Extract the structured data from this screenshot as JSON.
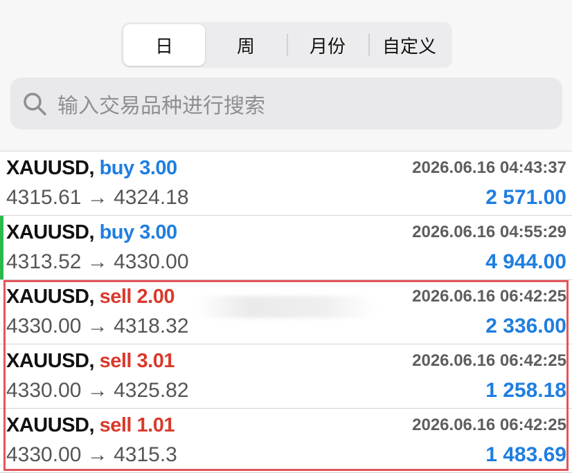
{
  "tabs": [
    {
      "label": "日",
      "active": true
    },
    {
      "label": "周",
      "active": false
    },
    {
      "label": "月份",
      "active": false
    },
    {
      "label": "自定义",
      "active": false
    }
  ],
  "search": {
    "placeholder": "输入交易品种进行搜索"
  },
  "colors": {
    "buy": "#1f7ee0",
    "sell": "#d9392b",
    "profit": "#1f7ee0",
    "accent_green": "#2db84d",
    "highlight": "#e2555a"
  },
  "trades": [
    {
      "symbol": "XAUUSD,",
      "side": "buy 3.00",
      "type": "buy",
      "time": "2026.06.16 04:43:37",
      "prices": "4315.61 → 4324.18",
      "profit": "2 571.00"
    },
    {
      "symbol": "XAUUSD,",
      "side": "buy 3.00",
      "type": "buy",
      "time": "2026.06.16 04:55:29",
      "prices": "4313.52 → 4330.00",
      "profit": "4 944.00",
      "accent": "green"
    },
    {
      "symbol": "XAUUSD,",
      "side": "sell 2.00",
      "type": "sell",
      "time": "2026.06.16 06:42:25",
      "prices": "4330.00 → 4318.32",
      "profit": "2 336.00"
    },
    {
      "symbol": "XAUUSD,",
      "side": "sell 3.01",
      "type": "sell",
      "time": "2026.06.16 06:42:25",
      "prices": "4330.00 → 4325.82",
      "profit": "1 258.18"
    },
    {
      "symbol": "XAUUSD,",
      "side": "sell 1.01",
      "type": "sell",
      "time": "2026.06.16 06:42:25",
      "prices": "4330.00 → 4315.3",
      "profit": "1 483.69"
    }
  ]
}
